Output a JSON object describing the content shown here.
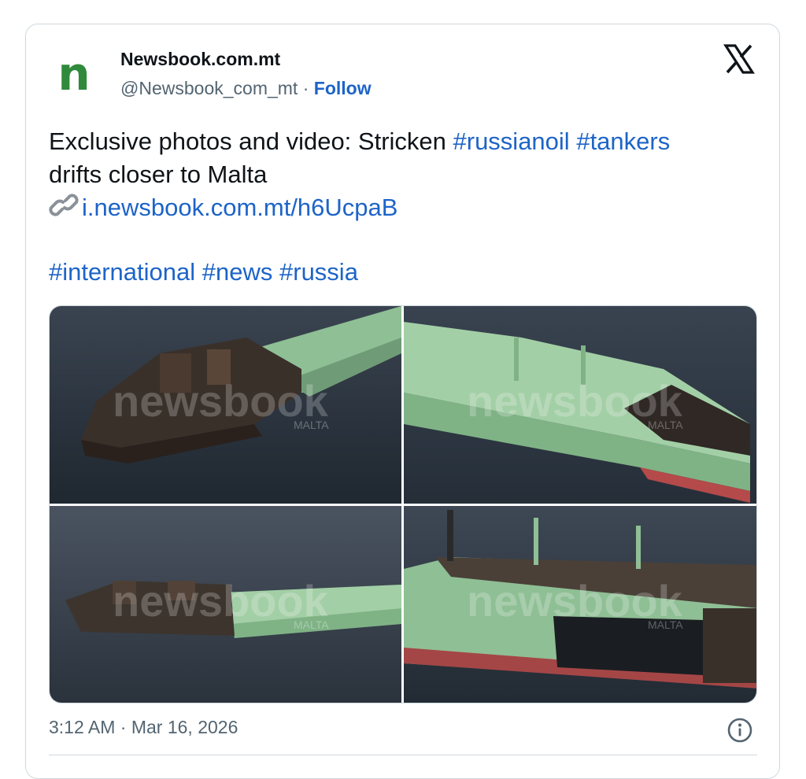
{
  "author": {
    "avatar_letter": "n",
    "name": "Newsbook.com.mt",
    "handle": "@Newsbook_com_mt",
    "separator": "·",
    "follow_label": "Follow"
  },
  "tweet": {
    "line1_text": "Exclusive photos and video: Stricken ",
    "tag_russianoil": "#russianoil",
    "tag_tankers": "#tankers",
    "line2_text": "drifts closer to Malta",
    "link_text": "i.newsbook.com.mt/h6UcpaB",
    "tag_international": "#international",
    "tag_news": "#news",
    "tag_russia": "#russia"
  },
  "media": {
    "watermark_main": "newsbook",
    "watermark_sub": "MALTA"
  },
  "footer": {
    "timestamp": "3:12 AM · Mar 16, 2026"
  },
  "colors": {
    "link_blue": "#1d64c8",
    "brand_green": "#2f8a3b",
    "hull_green": "#8fbf95",
    "sea": "#2b3540"
  },
  "icons": [
    "x-logo-icon",
    "link-icon",
    "info-icon"
  ]
}
